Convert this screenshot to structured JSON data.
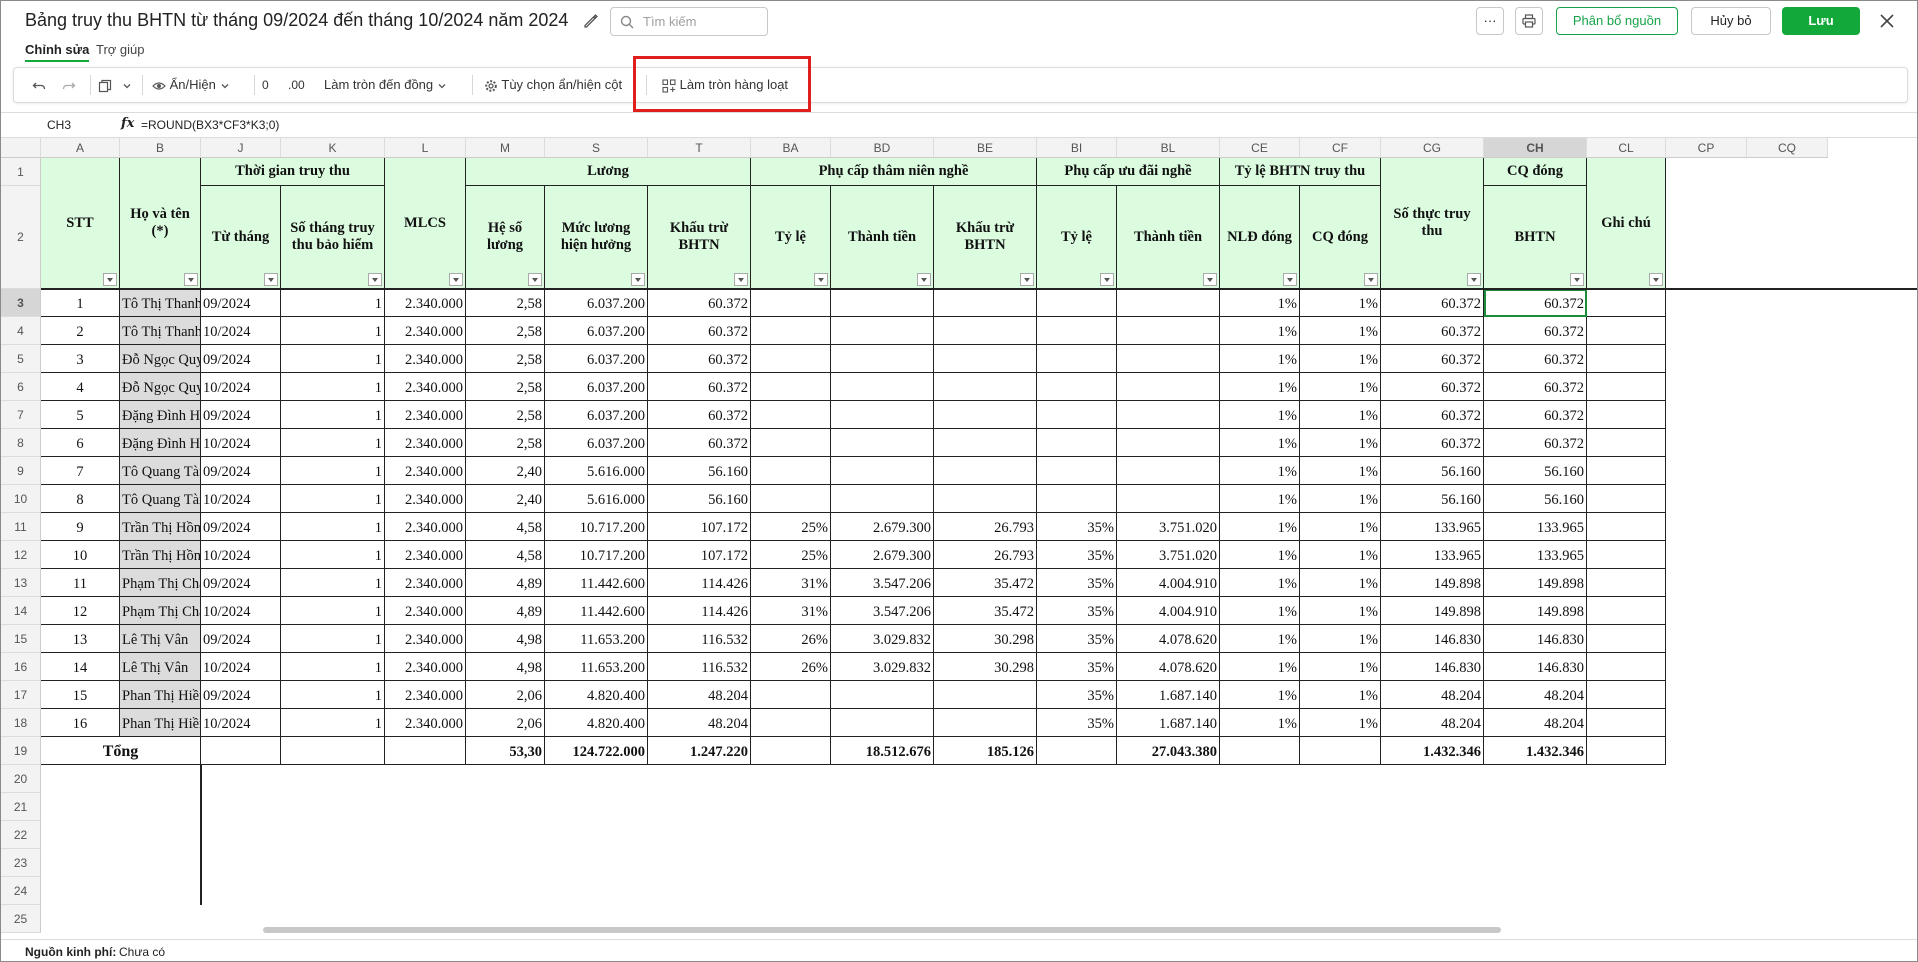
{
  "header": {
    "title": "Bảng truy thu BHTN từ tháng 09/2024 đến tháng 10/2024 năm 2024",
    "search_placeholder": "Tìm kiếm",
    "more_label": "···",
    "allocate_label": "Phân bổ nguồn",
    "cancel_label": "Hủy bỏ",
    "save_label": "Lưu"
  },
  "tabs": [
    {
      "label": "Chỉnh sửa",
      "active": true
    },
    {
      "label": "Trợ giúp",
      "active": false
    }
  ],
  "toolbar": {
    "show_hide_label": "Ẩn/Hiện",
    "decimal_decrease_label": "0",
    "decimal_increase_label": ".00",
    "round_label": "Làm tròn đến đồng",
    "column_options_label": "Tùy chọn ẩn/hiện cột",
    "batch_round_label": "Làm tròn hàng loạt"
  },
  "formula_bar": {
    "cell_ref": "CH3",
    "fx": "fx",
    "formula": "=ROUND(BX3*CF3*K3;0)"
  },
  "columns": [
    "A",
    "B",
    "J",
    "K",
    "L",
    "M",
    "S",
    "T",
    "BA",
    "BD",
    "BE",
    "BI",
    "BL",
    "CE",
    "CF",
    "CG",
    "CH",
    "CL",
    "CP",
    "CQ"
  ],
  "selected_column": "CH",
  "header_groups": {
    "thoi_gian": "Thời gian truy thu",
    "luong": "Lương",
    "pc_tham_nien": "Phụ cấp thâm niên nghề",
    "pc_uu_dai": "Phụ cấp ưu đãi nghề",
    "ty_le": "Tỷ lệ BHTN truy thu",
    "cq_dong": "CQ đóng"
  },
  "headers": {
    "stt": "STT",
    "ho_ten": "Họ và tên (*)",
    "tu_thang": "Từ tháng",
    "so_thang": "Số tháng truy thu bảo hiểm",
    "mlcs": "MLCS",
    "he_so": "Hệ số lương",
    "muc_luong": "Mức lương hiện hưởng",
    "khau_tru": "Khấu trừ BHTN",
    "ba_ty_le": "Tỷ lệ",
    "bd_thanh_tien": "Thành tiền",
    "be_khau_tru": "Khấu trừ BHTN",
    "bi_ty_le": "Tỷ lệ",
    "bl_thanh_tien": "Thành tiền",
    "nld_dong": "NLĐ đóng",
    "cq_dong": "CQ đóng",
    "so_thuc": "Số thực truy thu",
    "bhtn": "BHTN",
    "ghi_chu": "Ghi chú"
  },
  "row_numbers": [
    "1",
    "2",
    "3",
    "4",
    "5",
    "6",
    "7",
    "8",
    "9",
    "10",
    "11",
    "12",
    "13",
    "14",
    "15",
    "16",
    "17",
    "18",
    "19",
    "20",
    "21",
    "22",
    "23",
    "24",
    "25"
  ],
  "rows": [
    {
      "stt": "1",
      "name": "Tô Thị Thanh Vân",
      "month": "09/2024",
      "count": "1",
      "mlcs": "2.340.000",
      "hs": "2,58",
      "ml": "6.037.200",
      "kt": "60.372",
      "ba": "",
      "bd": "",
      "be": "",
      "bi": "",
      "bl": "",
      "ce": "1%",
      "cf": "1%",
      "cg": "60.372",
      "ch": "60.372"
    },
    {
      "stt": "2",
      "name": "Tô Thị Thanh Vân",
      "month": "10/2024",
      "count": "1",
      "mlcs": "2.340.000",
      "hs": "2,58",
      "ml": "6.037.200",
      "kt": "60.372",
      "ba": "",
      "bd": "",
      "be": "",
      "bi": "",
      "bl": "",
      "ce": "1%",
      "cf": "1%",
      "cg": "60.372",
      "ch": "60.372"
    },
    {
      "stt": "3",
      "name": "Đỗ Ngọc Quyết",
      "month": "09/2024",
      "count": "1",
      "mlcs": "2.340.000",
      "hs": "2,58",
      "ml": "6.037.200",
      "kt": "60.372",
      "ba": "",
      "bd": "",
      "be": "",
      "bi": "",
      "bl": "",
      "ce": "1%",
      "cf": "1%",
      "cg": "60.372",
      "ch": "60.372"
    },
    {
      "stt": "4",
      "name": "Đỗ Ngọc Quyết",
      "month": "10/2024",
      "count": "1",
      "mlcs": "2.340.000",
      "hs": "2,58",
      "ml": "6.037.200",
      "kt": "60.372",
      "ba": "",
      "bd": "",
      "be": "",
      "bi": "",
      "bl": "",
      "ce": "1%",
      "cf": "1%",
      "cg": "60.372",
      "ch": "60.372"
    },
    {
      "stt": "5",
      "name": "Đặng Đình Học",
      "month": "09/2024",
      "count": "1",
      "mlcs": "2.340.000",
      "hs": "2,58",
      "ml": "6.037.200",
      "kt": "60.372",
      "ba": "",
      "bd": "",
      "be": "",
      "bi": "",
      "bl": "",
      "ce": "1%",
      "cf": "1%",
      "cg": "60.372",
      "ch": "60.372"
    },
    {
      "stt": "6",
      "name": "Đặng Đình Học",
      "month": "10/2024",
      "count": "1",
      "mlcs": "2.340.000",
      "hs": "2,58",
      "ml": "6.037.200",
      "kt": "60.372",
      "ba": "",
      "bd": "",
      "be": "",
      "bi": "",
      "bl": "",
      "ce": "1%",
      "cf": "1%",
      "cg": "60.372",
      "ch": "60.372"
    },
    {
      "stt": "7",
      "name": "Tô Quang Tài",
      "month": "09/2024",
      "count": "1",
      "mlcs": "2.340.000",
      "hs": "2,40",
      "ml": "5.616.000",
      "kt": "56.160",
      "ba": "",
      "bd": "",
      "be": "",
      "bi": "",
      "bl": "",
      "ce": "1%",
      "cf": "1%",
      "cg": "56.160",
      "ch": "56.160"
    },
    {
      "stt": "8",
      "name": "Tô Quang Tài",
      "month": "10/2024",
      "count": "1",
      "mlcs": "2.340.000",
      "hs": "2,40",
      "ml": "5.616.000",
      "kt": "56.160",
      "ba": "",
      "bd": "",
      "be": "",
      "bi": "",
      "bl": "",
      "ce": "1%",
      "cf": "1%",
      "cg": "56.160",
      "ch": "56.160"
    },
    {
      "stt": "9",
      "name": "Trần Thị Hồng Hạnh",
      "month": "09/2024",
      "count": "1",
      "mlcs": "2.340.000",
      "hs": "4,58",
      "ml": "10.717.200",
      "kt": "107.172",
      "ba": "25%",
      "bd": "2.679.300",
      "be": "26.793",
      "bi": "35%",
      "bl": "3.751.020",
      "ce": "1%",
      "cf": "1%",
      "cg": "133.965",
      "ch": "133.965"
    },
    {
      "stt": "10",
      "name": "Trần Thị Hồng Hạnh",
      "month": "10/2024",
      "count": "1",
      "mlcs": "2.340.000",
      "hs": "4,58",
      "ml": "10.717.200",
      "kt": "107.172",
      "ba": "25%",
      "bd": "2.679.300",
      "be": "26.793",
      "bi": "35%",
      "bl": "3.751.020",
      "ce": "1%",
      "cf": "1%",
      "cg": "133.965",
      "ch": "133.965"
    },
    {
      "stt": "11",
      "name": "Phạm Thị Chà",
      "month": "09/2024",
      "count": "1",
      "mlcs": "2.340.000",
      "hs": "4,89",
      "ml": "11.442.600",
      "kt": "114.426",
      "ba": "31%",
      "bd": "3.547.206",
      "be": "35.472",
      "bi": "35%",
      "bl": "4.004.910",
      "ce": "1%",
      "cf": "1%",
      "cg": "149.898",
      "ch": "149.898"
    },
    {
      "stt": "12",
      "name": "Phạm Thị Chà",
      "month": "10/2024",
      "count": "1",
      "mlcs": "2.340.000",
      "hs": "4,89",
      "ml": "11.442.600",
      "kt": "114.426",
      "ba": "31%",
      "bd": "3.547.206",
      "be": "35.472",
      "bi": "35%",
      "bl": "4.004.910",
      "ce": "1%",
      "cf": "1%",
      "cg": "149.898",
      "ch": "149.898"
    },
    {
      "stt": "13",
      "name": "Lê Thị Vân",
      "month": "09/2024",
      "count": "1",
      "mlcs": "2.340.000",
      "hs": "4,98",
      "ml": "11.653.200",
      "kt": "116.532",
      "ba": "26%",
      "bd": "3.029.832",
      "be": "30.298",
      "bi": "35%",
      "bl": "4.078.620",
      "ce": "1%",
      "cf": "1%",
      "cg": "146.830",
      "ch": "146.830"
    },
    {
      "stt": "14",
      "name": "Lê Thị Vân",
      "month": "10/2024",
      "count": "1",
      "mlcs": "2.340.000",
      "hs": "4,98",
      "ml": "11.653.200",
      "kt": "116.532",
      "ba": "26%",
      "bd": "3.029.832",
      "be": "30.298",
      "bi": "35%",
      "bl": "4.078.620",
      "ce": "1%",
      "cf": "1%",
      "cg": "146.830",
      "ch": "146.830"
    },
    {
      "stt": "15",
      "name": "Phan Thị Hiền",
      "month": "09/2024",
      "count": "1",
      "mlcs": "2.340.000",
      "hs": "2,06",
      "ml": "4.820.400",
      "kt": "48.204",
      "ba": "",
      "bd": "",
      "be": "",
      "bi": "35%",
      "bl": "1.687.140",
      "ce": "1%",
      "cf": "1%",
      "cg": "48.204",
      "ch": "48.204"
    },
    {
      "stt": "16",
      "name": "Phan Thị Hiền",
      "month": "10/2024",
      "count": "1",
      "mlcs": "2.340.000",
      "hs": "2,06",
      "ml": "4.820.400",
      "kt": "48.204",
      "ba": "",
      "bd": "",
      "be": "",
      "bi": "35%",
      "bl": "1.687.140",
      "ce": "1%",
      "cf": "1%",
      "cg": "48.204",
      "ch": "48.204"
    }
  ],
  "total": {
    "label": "Tổng",
    "hs": "53,30",
    "ml": "124.722.000",
    "kt": "1.247.220",
    "bd": "18.512.676",
    "be": "185.126",
    "bl": "27.043.380",
    "cg": "1.432.346",
    "ch": "1.432.346"
  },
  "status": {
    "label": "Nguồn kinh phí:",
    "value": "Chưa có"
  }
}
